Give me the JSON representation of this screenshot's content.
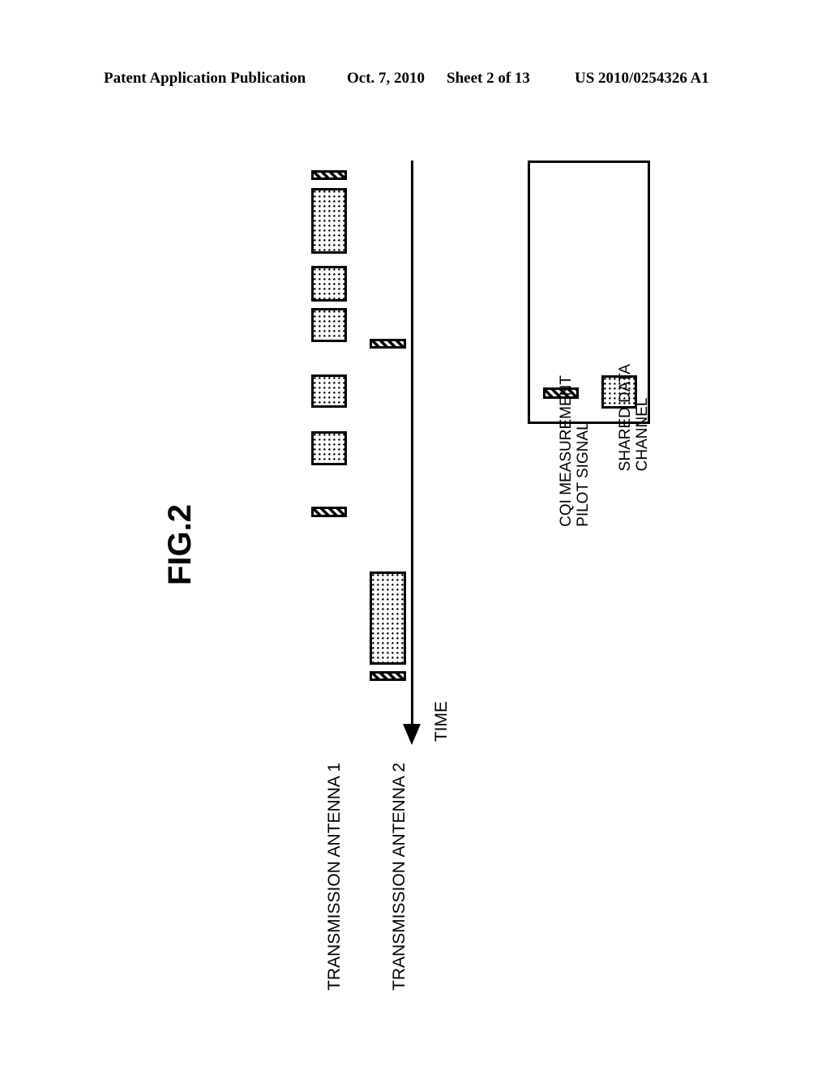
{
  "header": {
    "publication": "Patent Application Publication",
    "date": "Oct. 7, 2010",
    "sheet": "Sheet 2 of 13",
    "number": "US 2010/0254326 A1"
  },
  "figure": {
    "title": "FIG.2",
    "time_axis_label": "TIME",
    "rows": [
      {
        "label": "TRANSMISSION ANTENNA 1"
      },
      {
        "label": "TRANSMISSION ANTENNA 2"
      }
    ]
  },
  "legend": {
    "items": [
      {
        "pattern": "hatched-swatch",
        "line1": "CQI MEASUREMENT",
        "line2": "PILOT SIGNAL"
      },
      {
        "pattern": "dotted-swatch",
        "line1": "SHARED DATA",
        "line2": "CHANNEL"
      }
    ]
  },
  "chart_data": {
    "type": "timeline",
    "title": "FIG.2",
    "xlabel": "TIME",
    "axis_orientation": "vertical-down",
    "series": [
      {
        "name": "TRANSMISSION ANTENNA 1",
        "track_x": 384,
        "track_width": 44,
        "blocks": [
          {
            "kind": "pilot",
            "label": "CQI MEASUREMENT PILOT SIGNAL",
            "start": 210,
            "end": 222
          },
          {
            "kind": "data",
            "label": "SHARED DATA CHANNEL",
            "start": 232,
            "end": 313
          },
          {
            "kind": "data",
            "label": "SHARED DATA CHANNEL",
            "start": 328,
            "end": 372
          },
          {
            "kind": "data",
            "label": "SHARED DATA CHANNEL",
            "start": 380,
            "end": 422
          },
          {
            "kind": "data",
            "label": "SHARED DATA CHANNEL",
            "start": 462,
            "end": 503
          },
          {
            "kind": "data",
            "label": "SHARED DATA CHANNEL",
            "start": 532,
            "end": 574
          },
          {
            "kind": "pilot",
            "label": "CQI MEASUREMENT PILOT SIGNAL",
            "start": 625,
            "end": 638
          }
        ]
      },
      {
        "name": "TRANSMISSION ANTENNA 2",
        "track_x": 456,
        "track_width": 45,
        "blocks": [
          {
            "kind": "pilot",
            "label": "CQI MEASUREMENT PILOT SIGNAL",
            "start": 418,
            "end": 430
          },
          {
            "kind": "data",
            "label": "SHARED DATA CHANNEL",
            "start": 705,
            "end": 820
          },
          {
            "kind": "pilot",
            "label": "CQI MEASUREMENT PILOT SIGNAL",
            "start": 828,
            "end": 840
          }
        ]
      }
    ]
  }
}
